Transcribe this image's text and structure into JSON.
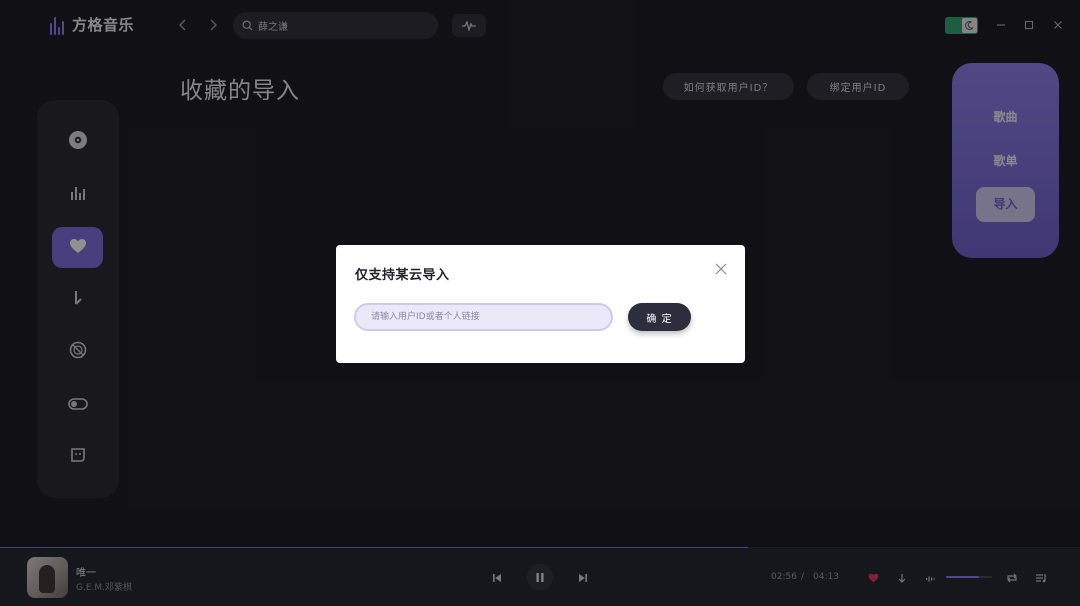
{
  "app": {
    "name": "方格音乐"
  },
  "search": {
    "value": "薛之谦"
  },
  "page": {
    "title": "收藏的导入",
    "how_to_get_id": "如何获取用户ID？",
    "bind_user_id": "绑定用户ID"
  },
  "right_panel": {
    "items": [
      "歌曲",
      "歌单",
      "导入"
    ],
    "active": "导入"
  },
  "sidebar": {
    "icons": [
      "disc-icon",
      "chart-bars-icon",
      "heart-icon",
      "download-icon",
      "vinyl-icon",
      "toggle-icon",
      "chat-icon"
    ],
    "active_index": 2
  },
  "dialog": {
    "title": "仅支持某云导入",
    "input_placeholder": "请输入用户ID或者个人链接",
    "confirm_label": "确 定"
  },
  "player": {
    "song_title": "唯一",
    "artist": "G.E.M.邓紫棋",
    "current_time": "02:56",
    "separator": "/",
    "total_time": "04:13",
    "progress": 0.693,
    "volume": 0.72
  },
  "colors": {
    "accent": "#7a67d9",
    "background": "#17171c",
    "theme_toggle": "#2ea36b",
    "favorite": "#e0354f"
  }
}
